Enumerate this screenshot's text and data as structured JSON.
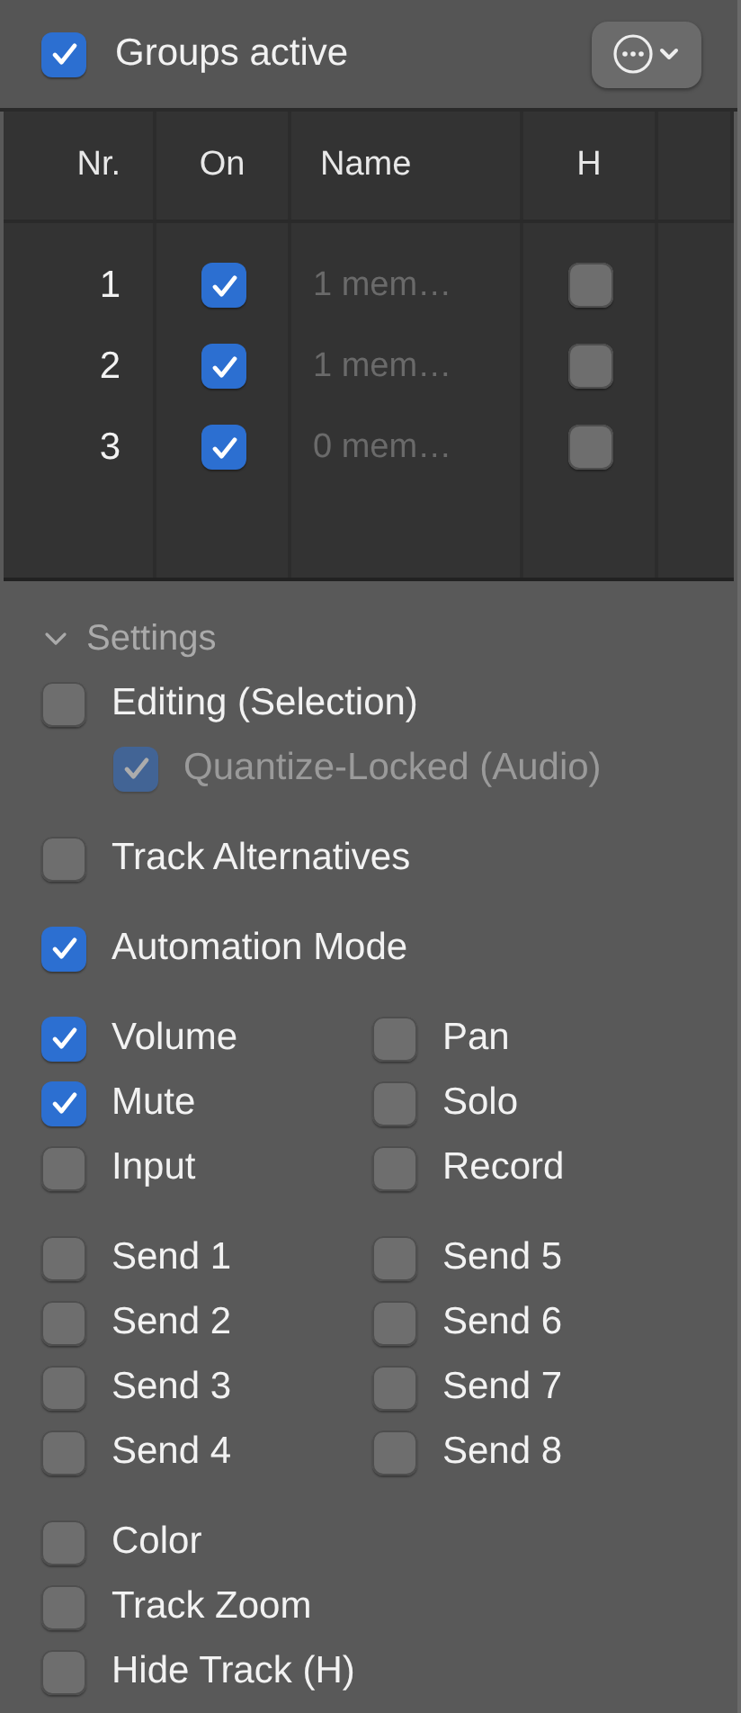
{
  "header": {
    "label": "Groups active",
    "checked": true
  },
  "table": {
    "columns": [
      "Nr.",
      "On",
      "Name",
      "H"
    ],
    "rows": [
      {
        "nr": "1",
        "on": true,
        "name": "1 mem…",
        "hide": false
      },
      {
        "nr": "2",
        "on": true,
        "name": "1 mem…",
        "hide": false
      },
      {
        "nr": "3",
        "on": true,
        "name": "0 mem…",
        "hide": false
      }
    ]
  },
  "settings": {
    "title": "Settings",
    "expanded": true,
    "sections": [
      {
        "kind": "list",
        "items": [
          {
            "label": "Editing (Selection)",
            "checked": false,
            "disabled": false,
            "kind": "main"
          },
          {
            "label": "Quantize-Locked (Audio)",
            "checked": true,
            "disabled": true,
            "kind": "sub"
          }
        ]
      },
      {
        "kind": "list",
        "items": [
          {
            "label": "Track Alternatives",
            "checked": false,
            "disabled": false,
            "kind": "main"
          }
        ]
      },
      {
        "kind": "list",
        "items": [
          {
            "label": "Automation Mode",
            "checked": true,
            "disabled": false,
            "kind": "main"
          }
        ]
      },
      {
        "kind": "grid",
        "items": [
          {
            "label": "Volume",
            "checked": true
          },
          {
            "label": "Pan",
            "checked": false
          },
          {
            "label": "Mute",
            "checked": true
          },
          {
            "label": "Solo",
            "checked": false
          },
          {
            "label": "Input",
            "checked": false
          },
          {
            "label": "Record",
            "checked": false
          }
        ]
      },
      {
        "kind": "grid",
        "items": [
          {
            "label": "Send 1",
            "checked": false
          },
          {
            "label": "Send 5",
            "checked": false
          },
          {
            "label": "Send 2",
            "checked": false
          },
          {
            "label": "Send 6",
            "checked": false
          },
          {
            "label": "Send 3",
            "checked": false
          },
          {
            "label": "Send 7",
            "checked": false
          },
          {
            "label": "Send 4",
            "checked": false
          },
          {
            "label": "Send 8",
            "checked": false
          }
        ]
      },
      {
        "kind": "list",
        "items": [
          {
            "label": "Color",
            "checked": false,
            "disabled": false,
            "kind": "main"
          },
          {
            "label": "Track Zoom",
            "checked": false,
            "disabled": false,
            "kind": "main"
          },
          {
            "label": "Hide Track (H)",
            "checked": false,
            "disabled": false,
            "kind": "main"
          }
        ]
      }
    ]
  }
}
